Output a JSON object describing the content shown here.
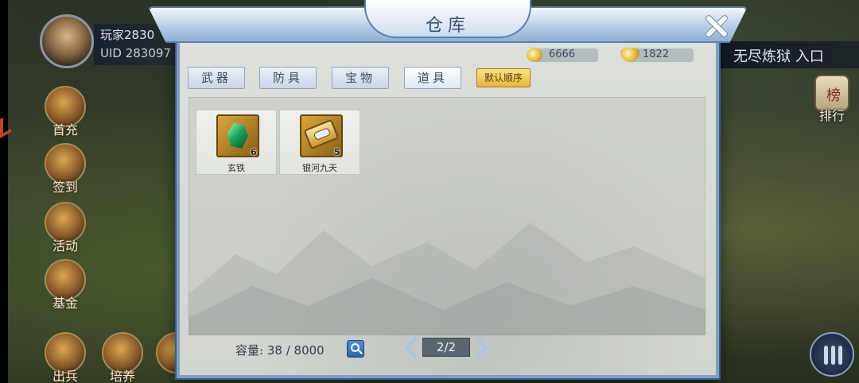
{
  "player": {
    "name": "玩家2830",
    "uid": "UID 283097"
  },
  "left_menu": [
    {
      "label": "首充",
      "icon": "first-recharge-icon"
    },
    {
      "label": "签到",
      "icon": "sign-in-scroll-icon"
    },
    {
      "label": "活动",
      "icon": "activity-icon"
    },
    {
      "label": "基金",
      "icon": "fund-icon"
    }
  ],
  "bottom_menu": [
    {
      "label": "出兵",
      "icon": "troops-icon"
    },
    {
      "label": "培养",
      "icon": "train-gourd-icon"
    }
  ],
  "right_entry": {
    "label": "无尽炼狱 入口"
  },
  "rank": {
    "label": "排行",
    "badge": "榜"
  },
  "warehouse": {
    "title": "仓库",
    "currency": [
      {
        "icon": "copper-coin-icon",
        "value": "6666"
      },
      {
        "icon": "gold-ingot-icon",
        "value": "1822"
      }
    ],
    "tabs": [
      {
        "label": "武器",
        "active": false
      },
      {
        "label": "防具",
        "active": false
      },
      {
        "label": "宝物",
        "active": false
      },
      {
        "label": "道具",
        "active": true
      }
    ],
    "sort_label": "默认顺序",
    "items": [
      {
        "name": "玄铁",
        "count": "6",
        "icon": "green-gem-icon"
      },
      {
        "name": "银河九天",
        "count": "5",
        "icon": "golden-scroll-icon"
      }
    ],
    "capacity_label": "容量:",
    "capacity_value": "38 / 8000",
    "page": "2/2"
  },
  "colors": {
    "panel_border": "#7d9fc4",
    "title_text": "#3a4f6e",
    "sort_button": "#e7b63a",
    "search_button": "#2b64a8"
  }
}
